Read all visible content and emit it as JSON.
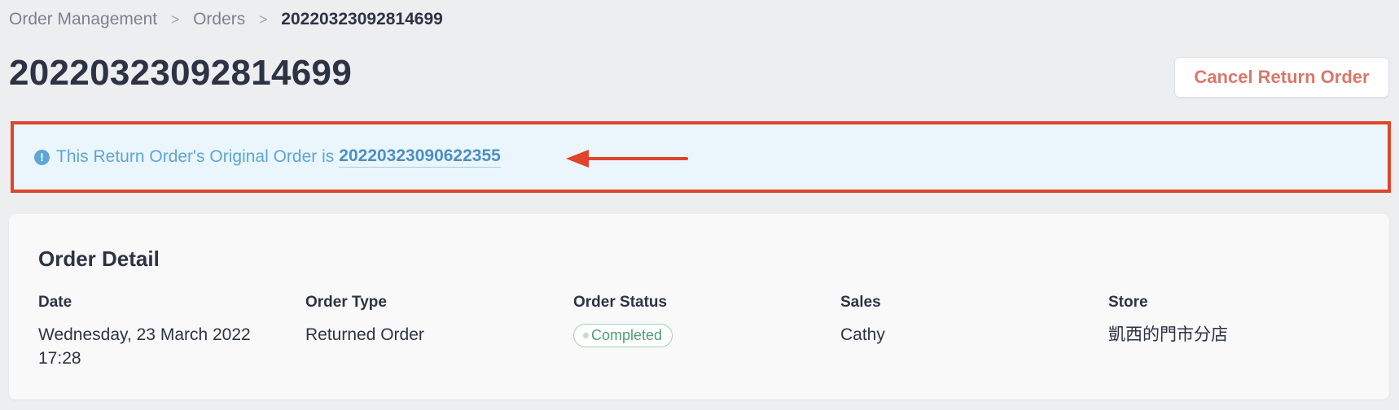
{
  "breadcrumb": {
    "items": [
      "Order Management",
      "Orders"
    ],
    "separator": ">",
    "current": "20220323092814699"
  },
  "page": {
    "title": "20220323092814699"
  },
  "actions": {
    "cancel_label": "Cancel Return Order"
  },
  "alert": {
    "icon": "info-icon",
    "icon_glyph": "!",
    "text": "This Return Order's Original Order is",
    "link_text": "20220323090622355",
    "highlight_color": "#e0442a"
  },
  "order_detail": {
    "title": "Order Detail",
    "fields": [
      {
        "label": "Date",
        "value": "Wednesday, 23 March 2022 17:28"
      },
      {
        "label": "Order Type",
        "value": "Returned Order"
      },
      {
        "label": "Order Status",
        "value": "Completed"
      },
      {
        "label": "Sales",
        "value": "Cathy"
      },
      {
        "label": "Store",
        "value": "凱西的門市分店"
      }
    ]
  },
  "colors": {
    "background": "#edeef0",
    "danger_text": "#d9786a",
    "info": "#5da6d6",
    "success": "#4f9d73"
  }
}
